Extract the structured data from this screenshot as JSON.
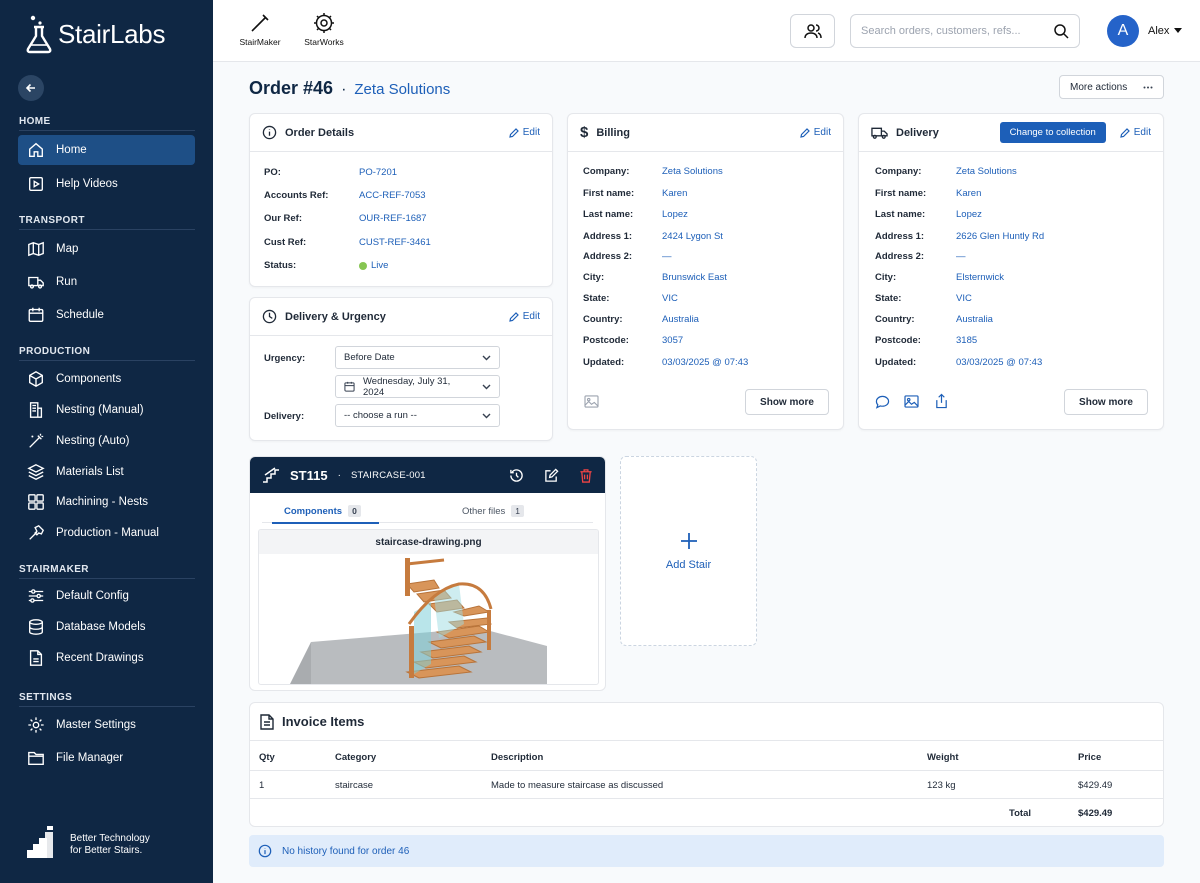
{
  "brand": {
    "name": "StairLabs",
    "tagline": "Better Technology for Better Stairs.",
    "accent": "#1d5fb8",
    "sidebar_bg": "#0f2744"
  },
  "sidebar": {
    "sections": [
      {
        "title": "HOME",
        "items": [
          {
            "label": "Home",
            "icon": "home-icon",
            "active": true
          },
          {
            "label": "Help Videos",
            "icon": "play-icon"
          }
        ]
      },
      {
        "title": "TRANSPORT",
        "items": [
          {
            "label": "Map",
            "icon": "map-icon"
          },
          {
            "label": "Run",
            "icon": "truck-icon"
          },
          {
            "label": "Schedule",
            "icon": "calendar-icon"
          }
        ]
      },
      {
        "title": "PRODUCTION",
        "items": [
          {
            "label": "Components",
            "icon": "cube-icon"
          },
          {
            "label": "Nesting (Manual)",
            "icon": "nesting-manual-icon"
          },
          {
            "label": "Nesting (Auto)",
            "icon": "wand-icon"
          },
          {
            "label": "Materials List",
            "icon": "layers-icon"
          },
          {
            "label": "Machining - Nests",
            "icon": "machining-icon"
          },
          {
            "label": "Production - Manual",
            "icon": "hammer-icon"
          }
        ]
      },
      {
        "title": "STAIRMAKER",
        "items": [
          {
            "label": "Default Config",
            "icon": "sliders-icon"
          },
          {
            "label": "Database Models",
            "icon": "database-icon"
          },
          {
            "label": "Recent Drawings",
            "icon": "document-icon"
          }
        ]
      },
      {
        "title": "SETTINGS",
        "items": [
          {
            "label": "Master Settings",
            "icon": "gear-icon"
          },
          {
            "label": "File Manager",
            "icon": "folder-icon"
          }
        ]
      }
    ]
  },
  "topbar": {
    "apps": [
      {
        "label": "StairMaker",
        "icon": "stairmaker-icon"
      },
      {
        "label": "StarWorks",
        "icon": "starworks-gear-icon"
      }
    ],
    "search_placeholder": "Search orders, customers, refs...",
    "avatar_initial": "A",
    "user_name": "Alex"
  },
  "order": {
    "title": "Order #46",
    "separator": "·",
    "customer": "Zeta Solutions",
    "more_actions": "More actions"
  },
  "order_details": {
    "title": "Order Details",
    "edit": "Edit",
    "rows": [
      {
        "label": "PO:",
        "value": "PO-7201"
      },
      {
        "label": "Accounts Ref:",
        "value": "ACC-REF-7053"
      },
      {
        "label": "Our Ref:",
        "value": "OUR-REF-1687"
      },
      {
        "label": "Cust Ref:",
        "value": "CUST-REF-3461"
      }
    ],
    "status_label": "Status:",
    "status_value": "Live"
  },
  "urgency": {
    "title": "Delivery & Urgency",
    "edit": "Edit",
    "urgency_label": "Urgency:",
    "urgency_value": "Before Date",
    "date_value": "Wednesday, July 31, 2024",
    "delivery_label": "Delivery:",
    "delivery_value": "-- choose a run --"
  },
  "billing": {
    "title": "Billing",
    "edit": "Edit",
    "rows": [
      {
        "label": "Company:",
        "value": "Zeta Solutions"
      },
      {
        "label": "First name:",
        "value": "Karen"
      },
      {
        "label": "Last name:",
        "value": "Lopez"
      },
      {
        "label": "Address 1:",
        "value": "2424 Lygon St"
      },
      {
        "label": "Address 2:",
        "value": "—"
      },
      {
        "label": "City:",
        "value": "Brunswick East"
      },
      {
        "label": "State:",
        "value": "VIC"
      },
      {
        "label": "Country:",
        "value": "Australia"
      },
      {
        "label": "Postcode:",
        "value": "3057"
      },
      {
        "label": "Updated:",
        "value": "03/03/2025 @ 07:43"
      }
    ],
    "show_more": "Show more"
  },
  "delivery": {
    "title": "Delivery",
    "edit": "Edit",
    "change_btn": "Change to collection",
    "rows": [
      {
        "label": "Company:",
        "value": "Zeta Solutions"
      },
      {
        "label": "First name:",
        "value": "Karen"
      },
      {
        "label": "Last name:",
        "value": "Lopez"
      },
      {
        "label": "Address 1:",
        "value": "2626 Glen Huntly Rd"
      },
      {
        "label": "Address 2:",
        "value": "—"
      },
      {
        "label": "City:",
        "value": "Elsternwick"
      },
      {
        "label": "State:",
        "value": "VIC"
      },
      {
        "label": "Country:",
        "value": "Australia"
      },
      {
        "label": "Postcode:",
        "value": "3185"
      },
      {
        "label": "Updated:",
        "value": "03/03/2025 @ 07:43"
      }
    ],
    "show_more": "Show more"
  },
  "stair": {
    "id": "ST115",
    "name": "STAIRCASE-001",
    "tabs": [
      {
        "label": "Components",
        "count": "0",
        "active": true
      },
      {
        "label": "Other files",
        "count": "1"
      }
    ],
    "file_name": "staircase-drawing.png"
  },
  "add_stair": "Add Stair",
  "invoice": {
    "title": "Invoice Items",
    "columns": [
      "Qty",
      "Category",
      "Description",
      "Weight",
      "Price"
    ],
    "rows": [
      {
        "qty": "1",
        "category": "staircase",
        "description": "Made to measure staircase as discussed",
        "weight": "123 kg",
        "price": "$429.49"
      }
    ],
    "total_label": "Total",
    "total_value": "$429.49"
  },
  "history": "No history found for order 46"
}
